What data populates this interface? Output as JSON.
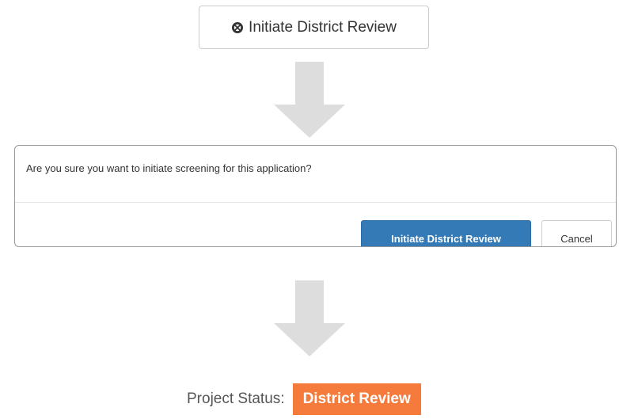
{
  "top_button": {
    "label": "Initiate District Review",
    "icon": "ban-circle-icon"
  },
  "arrows": {
    "icon": "arrow-down-icon",
    "color": "#dddddd"
  },
  "dialog": {
    "message": "Are you sure you want to initiate screening for this application?",
    "confirm_label": "Initiate District Review",
    "cancel_label": "Cancel"
  },
  "status": {
    "label": "Project Status:",
    "value": "District Review",
    "badge_color": "#f47b3b"
  },
  "colors": {
    "primary": "#337ab7",
    "border": "#cccccc"
  }
}
